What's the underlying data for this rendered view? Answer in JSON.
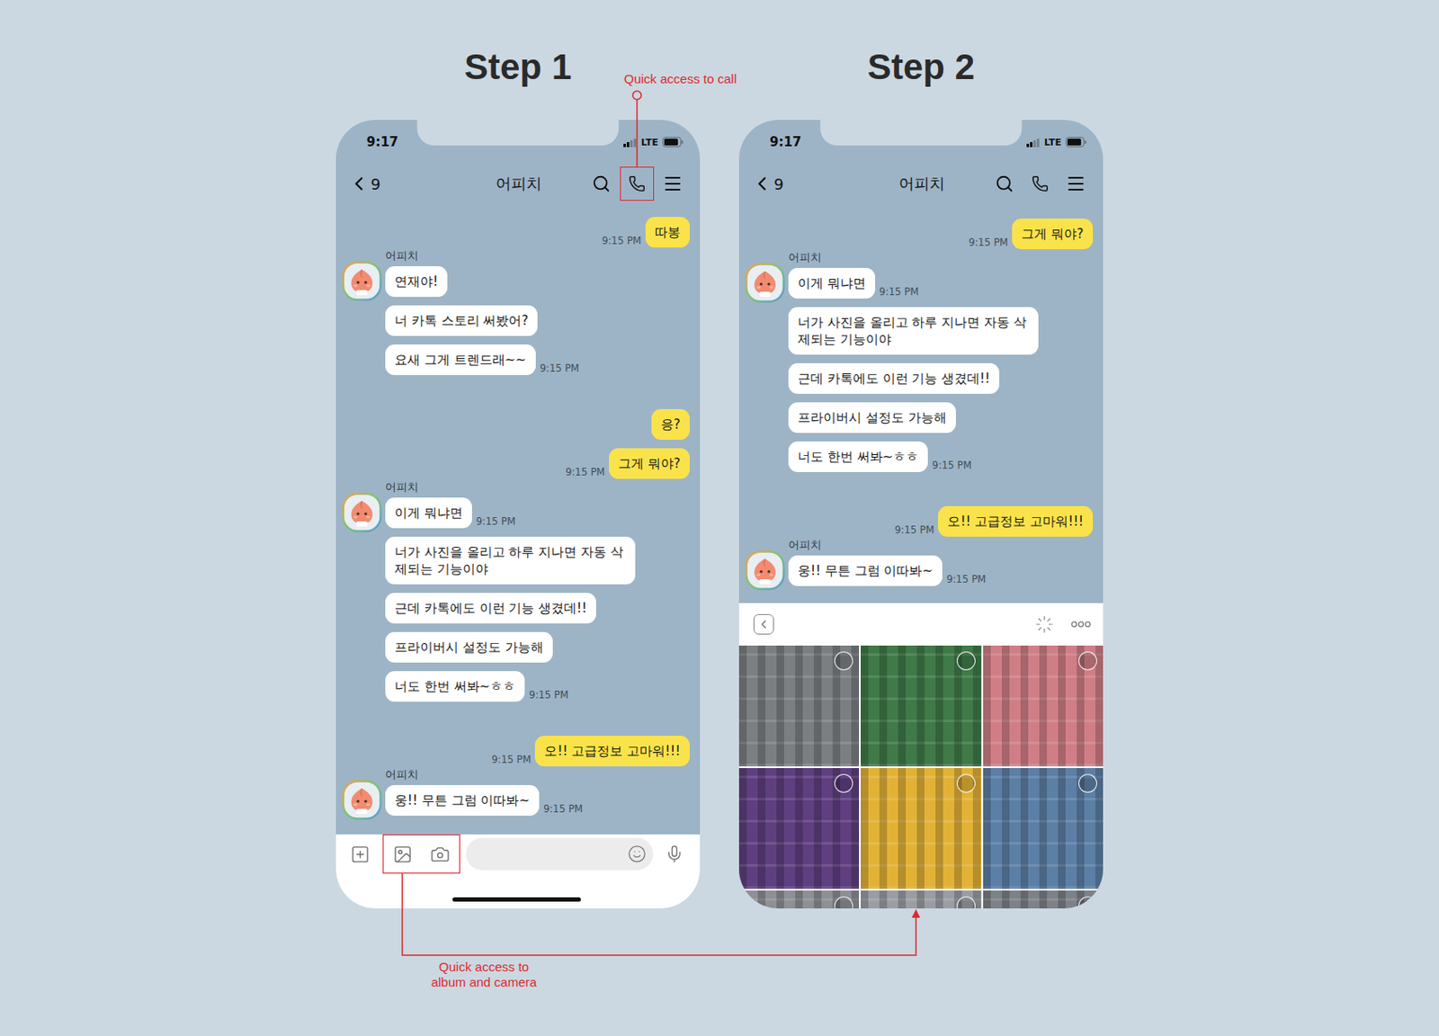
{
  "steps": [
    {
      "title": "Step 1",
      "status_bar": {
        "time": "9:17",
        "network": "LTE",
        "signal_level": 0.5,
        "battery_level": 0.9
      },
      "header": {
        "back_count": "9",
        "title": "어피치",
        "call_highlighted": true
      },
      "messages": [
        {
          "kind": "sent",
          "bubbles": [
            {
              "text": "따봉",
              "time": "9:15 PM"
            }
          ]
        },
        {
          "kind": "received",
          "name": "어피치",
          "bubbles": [
            {
              "text": "연재야!"
            },
            {
              "text": "너 카톡 스토리 써봤어?"
            },
            {
              "text": "요새 그게 트렌드래~~",
              "time": "9:15 PM"
            }
          ]
        },
        {
          "kind": "sent",
          "bubbles": [
            {
              "text": "응?"
            },
            {
              "text": "그게 뭐야?",
              "time": "9:15 PM"
            }
          ]
        },
        {
          "kind": "received",
          "name": "어피치",
          "bubbles": [
            {
              "text": "이게 뭐냐면",
              "time": "9:15 PM"
            },
            {
              "text": "너가 사진을 올리고 하루 지나면 자동 삭제되는 기능이야"
            },
            {
              "text": "근데 카톡에도 이런 기능 생겼데!!"
            },
            {
              "text": "프라이버시 설정도 가능해"
            },
            {
              "text": "너도 한번 써봐~ㅎㅎ",
              "time": "9:15 PM"
            }
          ]
        },
        {
          "kind": "sent",
          "bubbles": [
            {
              "text": "오!! 고급정보 고마워!!!",
              "time": "9:15 PM"
            }
          ]
        },
        {
          "kind": "received",
          "name": "어피치",
          "bubbles": [
            {
              "text": "웅!! 무튼 그럼 이따봐~",
              "time": "9:15 PM"
            }
          ]
        }
      ],
      "bottom": {
        "kind": "composer",
        "media_highlighted": true
      }
    },
    {
      "title": "Step 2",
      "status_bar": {
        "time": "9:17",
        "network": "LTE",
        "signal_level": 0.5,
        "battery_level": 0.9
      },
      "header": {
        "back_count": "9",
        "title": "어피치",
        "call_highlighted": false
      },
      "messages": [
        {
          "kind": "sent",
          "bubbles": [
            {
              "text": "그게 뭐야?",
              "time": "9:15 PM"
            }
          ]
        },
        {
          "kind": "received",
          "name": "어피치",
          "bubbles": [
            {
              "text": "이게 뭐냐면",
              "time": "9:15 PM"
            },
            {
              "text": "너가 사진을 올리고 하루 지나면 자동 삭제되는 기능이야"
            },
            {
              "text": "근데 카톡에도 이런 기능 생겼데!!"
            },
            {
              "text": "프라이버시 설정도 가능해"
            },
            {
              "text": "너도 한번 써봐~ㅎㅎ",
              "time": "9:15 PM"
            }
          ]
        },
        {
          "kind": "sent",
          "bubbles": [
            {
              "text": "오!! 고급정보 고마워!!!",
              "time": "9:15 PM"
            }
          ]
        },
        {
          "kind": "received",
          "name": "어피치",
          "bubbles": [
            {
              "text": "웅!! 무튼 그럼 이따봐~",
              "time": "9:15 PM"
            }
          ]
        }
      ],
      "bottom": {
        "kind": "photo_picker",
        "photos": [
          {
            "color": "#7c7f82",
            "selected": false
          },
          {
            "color": "#3f7a48",
            "selected": false
          },
          {
            "color": "#d07e86",
            "selected": false
          },
          {
            "color": "#5f3f80",
            "selected": false
          },
          {
            "color": "#e2b236",
            "selected": false
          },
          {
            "color": "#5c7fa6",
            "selected": false
          },
          {
            "color": "#8d9094",
            "selected": false
          },
          {
            "color": "#9a9ea3",
            "selected": false
          },
          {
            "color": "#7d8288",
            "selected": false
          }
        ]
      }
    }
  ],
  "annotations": {
    "call": "Quick access to call",
    "media": "Quick access to album and camera"
  }
}
